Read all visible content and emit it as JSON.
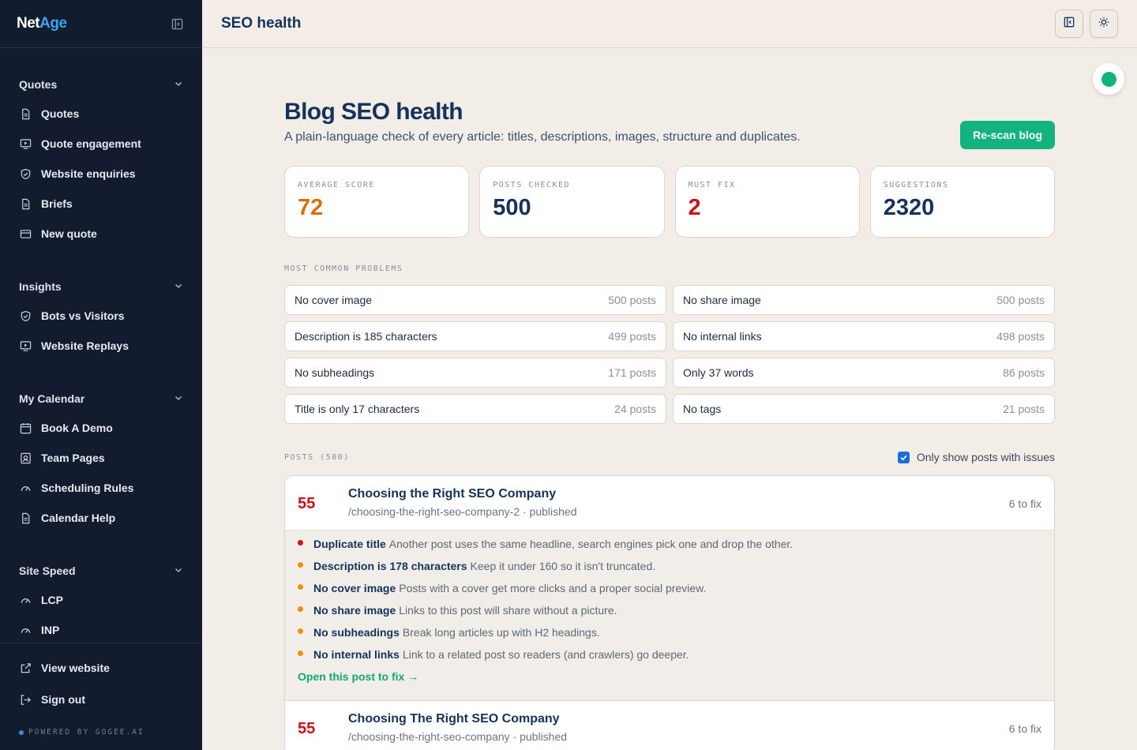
{
  "sidebar": {
    "logo_part1": "Net",
    "logo_part2": "Age",
    "groups": [
      {
        "title": "Quotes",
        "items": [
          {
            "label": "Quotes",
            "icon": "document-icon"
          },
          {
            "label": "Quote engagement",
            "icon": "monitor-play-icon"
          },
          {
            "label": "Website enquiries",
            "icon": "shield-check-icon"
          },
          {
            "label": "Briefs",
            "icon": "document-icon"
          },
          {
            "label": "New quote",
            "icon": "card-icon"
          }
        ]
      },
      {
        "title": "Insights",
        "items": [
          {
            "label": "Bots vs Visitors",
            "icon": "shield-check-icon"
          },
          {
            "label": "Website Replays",
            "icon": "monitor-play-icon"
          }
        ]
      },
      {
        "title": "My Calendar",
        "items": [
          {
            "label": "Book A Demo",
            "icon": "calendar-icon"
          },
          {
            "label": "Team Pages",
            "icon": "user-badge-icon"
          },
          {
            "label": "Scheduling Rules",
            "icon": "gauge-icon"
          },
          {
            "label": "Calendar Help",
            "icon": "document-icon"
          }
        ]
      },
      {
        "title": "Site Speed",
        "items": [
          {
            "label": "LCP",
            "icon": "gauge-icon"
          },
          {
            "label": "INP",
            "icon": "gauge-icon"
          }
        ]
      }
    ],
    "footer": {
      "view_website": "View website",
      "sign_out": "Sign out",
      "powered": "POWERED BY GOGEE.AI"
    }
  },
  "topbar": {
    "title": "SEO health"
  },
  "page": {
    "title": "Blog SEO health",
    "subtitle": "A plain-language check of every article: titles, descriptions, images, structure and duplicates.",
    "rescan_label": "Re-scan blog"
  },
  "stats": [
    {
      "label": "AVERAGE SCORE",
      "value": "72",
      "color": "#d9700a"
    },
    {
      "label": "POSTS CHECKED",
      "value": "500",
      "color": "#14325a"
    },
    {
      "label": "MUST FIX",
      "value": "2",
      "color": "#d0101d"
    },
    {
      "label": "SUGGESTIONS",
      "value": "2320",
      "color": "#14325a"
    }
  ],
  "problems": {
    "label": "MOST COMMON PROBLEMS",
    "items": [
      {
        "name": "No cover image",
        "count": "500 posts"
      },
      {
        "name": "No share image",
        "count": "500 posts"
      },
      {
        "name": "Description is 185 characters",
        "count": "499 posts"
      },
      {
        "name": "No internal links",
        "count": "498 posts"
      },
      {
        "name": "No subheadings",
        "count": "171 posts"
      },
      {
        "name": "Only 37 words",
        "count": "86 posts"
      },
      {
        "name": "Title is only 17 characters",
        "count": "24 posts"
      },
      {
        "name": "No tags",
        "count": "21 posts"
      }
    ]
  },
  "posts": {
    "label": "POSTS (500)",
    "filter_label": "Only show posts with issues",
    "filter_checked": true,
    "open_label": "Open this post to fix →",
    "items": [
      {
        "score": "55",
        "title": "Choosing the Right SEO Company",
        "slug": "/choosing-the-right-seo-company-2 · published",
        "fix": "6 to fix",
        "issues": [
          {
            "title": "Duplicate title",
            "desc": "Another post uses the same headline, search engines pick one and drop the other.",
            "severity": "#d0101d"
          },
          {
            "title": "Description is 178 characters",
            "desc": "Keep it under 160 so it isn't truncated.",
            "severity": "#f0900a"
          },
          {
            "title": "No cover image",
            "desc": "Posts with a cover get more clicks and a proper social preview.",
            "severity": "#f0900a"
          },
          {
            "title": "No share image",
            "desc": "Links to this post will share without a picture.",
            "severity": "#f0900a"
          },
          {
            "title": "No subheadings",
            "desc": "Break long articles up with H2 headings.",
            "severity": "#f0900a"
          },
          {
            "title": "No internal links",
            "desc": "Link to a related post so readers (and crawlers) go deeper.",
            "severity": "#f0900a"
          }
        ]
      },
      {
        "score": "55",
        "title": "Choosing The Right SEO Company",
        "slug": "/choosing-the-right-seo-company · published",
        "fix": "6 to fix"
      }
    ]
  }
}
